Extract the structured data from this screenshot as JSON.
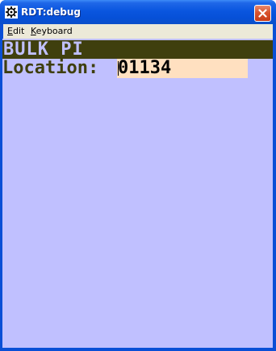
{
  "window": {
    "title": "RDT:debug"
  },
  "menu": {
    "items": [
      {
        "label_u": "E",
        "label_rest": "dit"
      },
      {
        "label_u": "K",
        "label_rest": "eyboard"
      }
    ]
  },
  "screen": {
    "title": "BULK PI",
    "field_label": "Location:",
    "field_value": "01134"
  },
  "colors": {
    "client_background": "#c0c0ff",
    "header_band": "#3f3f0e",
    "input_background": "#ffe0c0",
    "titlebar": "#0a56df"
  },
  "icons": {
    "app": "gear-icon",
    "close": "close-icon"
  }
}
